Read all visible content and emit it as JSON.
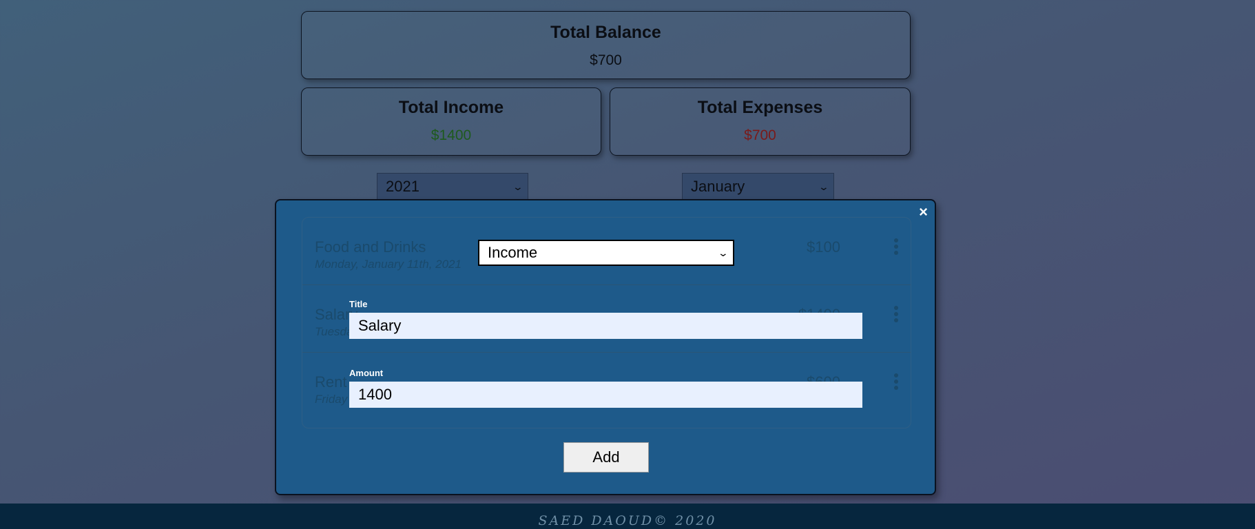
{
  "summary": {
    "balance_title": "Total Balance",
    "balance_value": "$700",
    "income_title": "Total Income",
    "income_value": "$1400",
    "expenses_title": "Total Expenses",
    "expenses_value": "$700",
    "income_color": "#1e5a1e",
    "expenses_color": "#7a1a1a"
  },
  "filters": {
    "year": "2021",
    "month": "January"
  },
  "transactions": [
    {
      "title": "Food and Drinks",
      "date": "Monday, January 11th, 2021",
      "amount": "$100"
    },
    {
      "title": "Salary",
      "date": "Tuesday",
      "amount": "$1400"
    },
    {
      "title": "Rent",
      "date": "Friday",
      "amount": "$600"
    }
  ],
  "modal": {
    "close_icon": "×",
    "type_value": "Income",
    "title_label": "Title",
    "title_value": "Salary",
    "amount_label": "Amount",
    "amount_value": "1400",
    "add_label": "Add"
  },
  "footer": {
    "text": "SAED DAOUD© 2020"
  }
}
